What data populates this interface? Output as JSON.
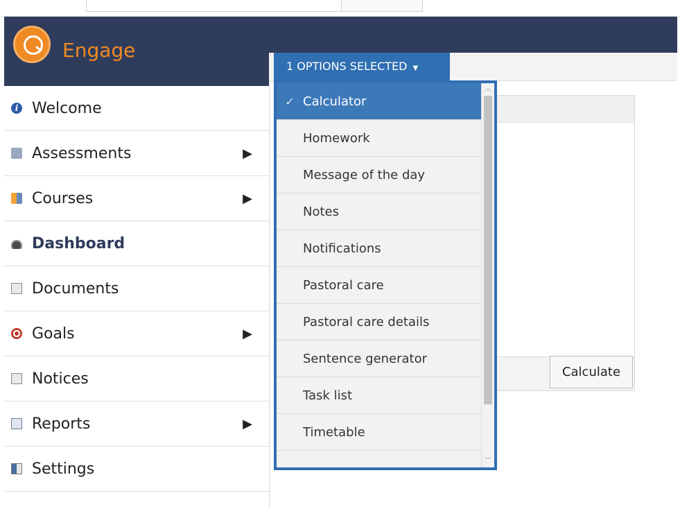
{
  "app": {
    "brand_name": "Engage",
    "colors": {
      "navy": "#2f3c5b",
      "orange": "#f08a24",
      "blue": "#2f6fb2"
    }
  },
  "sidebar": {
    "items": [
      {
        "label": "Welcome",
        "icon": "info-icon",
        "has_submenu": false,
        "active": false
      },
      {
        "label": "Assessments",
        "icon": "assessments-icon",
        "has_submenu": true,
        "active": false
      },
      {
        "label": "Courses",
        "icon": "courses-icon",
        "has_submenu": true,
        "active": false
      },
      {
        "label": "Dashboard",
        "icon": "dashboard-icon",
        "has_submenu": false,
        "active": true
      },
      {
        "label": "Documents",
        "icon": "documents-icon",
        "has_submenu": false,
        "active": false
      },
      {
        "label": "Goals",
        "icon": "goals-icon",
        "has_submenu": true,
        "active": false
      },
      {
        "label": "Notices",
        "icon": "notices-icon",
        "has_submenu": false,
        "active": false
      },
      {
        "label": "Reports",
        "icon": "reports-icon",
        "has_submenu": true,
        "active": false
      },
      {
        "label": "Settings",
        "icon": "settings-icon",
        "has_submenu": false,
        "active": false
      }
    ],
    "submenu_arrow": "▶"
  },
  "toolbar": {
    "options_label": "1 OPTIONS SELECTED",
    "caret": "▼"
  },
  "dropdown": {
    "check_glyph": "✓",
    "options": [
      {
        "label": "Calculator",
        "selected": true
      },
      {
        "label": "Homework",
        "selected": false
      },
      {
        "label": "Message of the day",
        "selected": false
      },
      {
        "label": "Notes",
        "selected": false
      },
      {
        "label": "Notifications",
        "selected": false
      },
      {
        "label": "Pastoral care",
        "selected": false
      },
      {
        "label": "Pastoral care details",
        "selected": false
      },
      {
        "label": "Sentence generator",
        "selected": false
      },
      {
        "label": "Task list",
        "selected": false
      },
      {
        "label": "Timetable",
        "selected": false
      }
    ]
  },
  "panel": {
    "calculate_label": "Calculate"
  }
}
